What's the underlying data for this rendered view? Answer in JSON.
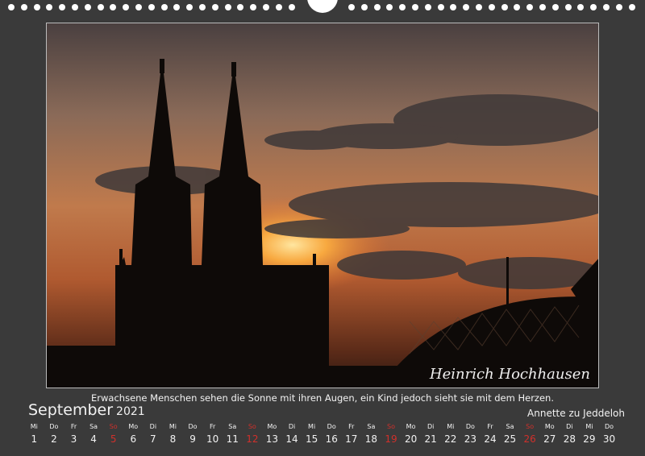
{
  "photo": {
    "description_icon": "cologne-cathedral-sunset-photo",
    "signature": "Heinrich Hochhausen"
  },
  "quote": "Erwachsene Menschen sehen die Sonne mit ihren Augen, ein Kind jedoch sieht sie mit dem Herzen.",
  "month": {
    "name": "September",
    "year": "2021"
  },
  "author": "Annette zu Jeddeloh",
  "colors": {
    "background": "#3a3a3a",
    "text": "#f2f2f2",
    "sunday": "#d0302b"
  },
  "days": [
    {
      "wd": "Mi",
      "dn": "1"
    },
    {
      "wd": "Do",
      "dn": "2"
    },
    {
      "wd": "Fr",
      "dn": "3"
    },
    {
      "wd": "Sa",
      "dn": "4"
    },
    {
      "wd": "So",
      "dn": "5"
    },
    {
      "wd": "Mo",
      "dn": "6"
    },
    {
      "wd": "Di",
      "dn": "7"
    },
    {
      "wd": "Mi",
      "dn": "8"
    },
    {
      "wd": "Do",
      "dn": "9"
    },
    {
      "wd": "Fr",
      "dn": "10"
    },
    {
      "wd": "Sa",
      "dn": "11"
    },
    {
      "wd": "So",
      "dn": "12"
    },
    {
      "wd": "Mo",
      "dn": "13"
    },
    {
      "wd": "Di",
      "dn": "14"
    },
    {
      "wd": "Mi",
      "dn": "15"
    },
    {
      "wd": "Do",
      "dn": "16"
    },
    {
      "wd": "Fr",
      "dn": "17"
    },
    {
      "wd": "Sa",
      "dn": "18"
    },
    {
      "wd": "So",
      "dn": "19"
    },
    {
      "wd": "Mo",
      "dn": "20"
    },
    {
      "wd": "Di",
      "dn": "21"
    },
    {
      "wd": "Mi",
      "dn": "22"
    },
    {
      "wd": "Do",
      "dn": "23"
    },
    {
      "wd": "Fr",
      "dn": "24"
    },
    {
      "wd": "Sa",
      "dn": "25"
    },
    {
      "wd": "So",
      "dn": "26"
    },
    {
      "wd": "Mo",
      "dn": "27"
    },
    {
      "wd": "Di",
      "dn": "28"
    },
    {
      "wd": "Mi",
      "dn": "29"
    },
    {
      "wd": "Do",
      "dn": "30"
    }
  ]
}
